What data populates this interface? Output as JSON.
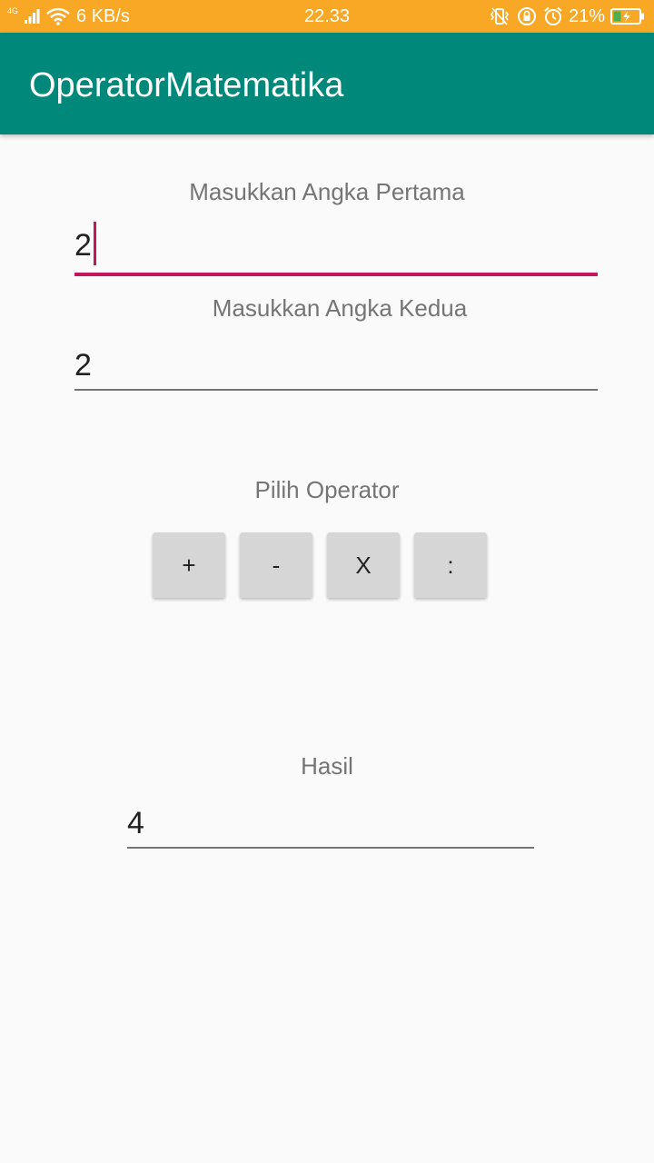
{
  "status_bar": {
    "network_type": "4G",
    "speed": "6 KB/s",
    "time": "22.33",
    "battery": "21%",
    "icons": [
      "signal-icon",
      "wifi-icon",
      "vibrate-icon",
      "rotation-lock-icon",
      "alarm-icon",
      "battery-charging-icon"
    ]
  },
  "app_bar": {
    "title": "OperatorMatematika"
  },
  "form": {
    "first_label": "Masukkan Angka Pertama",
    "first_value": "2",
    "second_label": "Masukkan Angka Kedua",
    "second_value": "2",
    "operator_label": "Pilih Operator",
    "operators": [
      "+",
      "-",
      "X",
      ":"
    ],
    "result_label": "Hasil",
    "result_value": "4"
  },
  "colors": {
    "status_bar": "#f9a825",
    "app_bar": "#00897b",
    "accent": "#c2185b",
    "button": "#d6d6d6",
    "battery_fill": "#4caf50"
  }
}
